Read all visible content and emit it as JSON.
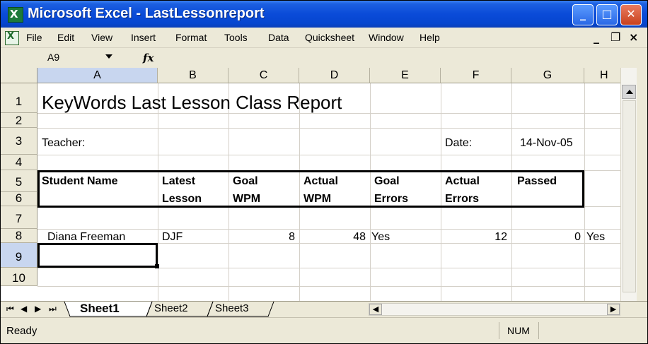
{
  "window": {
    "title": "Microsoft Excel - LastLessonreport",
    "app_icon_glyph": "X",
    "minimize_glyph": "_",
    "maximize_glyph": "□",
    "close_glyph": "✕"
  },
  "menubar": {
    "items": [
      "File",
      "Edit",
      "View",
      "Insert",
      "Format",
      "Tools",
      "Data",
      "Quicksheet",
      "Window",
      "Help"
    ],
    "minimize_glyph": "_",
    "restore_glyph": "❐",
    "close_glyph": "×"
  },
  "formula_bar": {
    "name_box": "A9",
    "fx_label": "fx",
    "formula": ""
  },
  "sheet": {
    "columns": [
      "A",
      "B",
      "C",
      "D",
      "E",
      "F",
      "G",
      "H"
    ],
    "rows": [
      "1",
      "2",
      "3",
      "4",
      "5",
      "6",
      "7",
      "8",
      "9",
      "10"
    ],
    "selected_cell": "A9",
    "cells": {
      "title": "KeyWords Last Lesson Class Report",
      "teacher_label": "Teacher:",
      "date_label": "Date:",
      "date_value": "14-Nov-05",
      "hdr_student": "Student Name",
      "hdr_latest": "Latest",
      "hdr_lesson": "Lesson",
      "hdr_goal1": "Goal",
      "hdr_wpm1": "WPM",
      "hdr_actual1": "Actual",
      "hdr_wpm2": "WPM",
      "hdr_goal2": "Goal",
      "hdr_errors1": "Errors",
      "hdr_actual2": "Actual",
      "hdr_errors2": "Errors",
      "hdr_passed": "Passed",
      "r8_a": "Diana Freeman",
      "r8_b": "DJF",
      "r8_c": "8",
      "r8_d": "48",
      "r8_e": "Yes",
      "r8_f": "12",
      "r8_g": "0",
      "r8_h": "Yes"
    }
  },
  "sheet_tabs": {
    "nav": [
      "⏮",
      "◀",
      "▶",
      "⏭"
    ],
    "tabs": [
      "Sheet1",
      "Sheet2",
      "Sheet3"
    ],
    "active": "Sheet1"
  },
  "status": {
    "left": "Ready",
    "num": "NUM"
  }
}
